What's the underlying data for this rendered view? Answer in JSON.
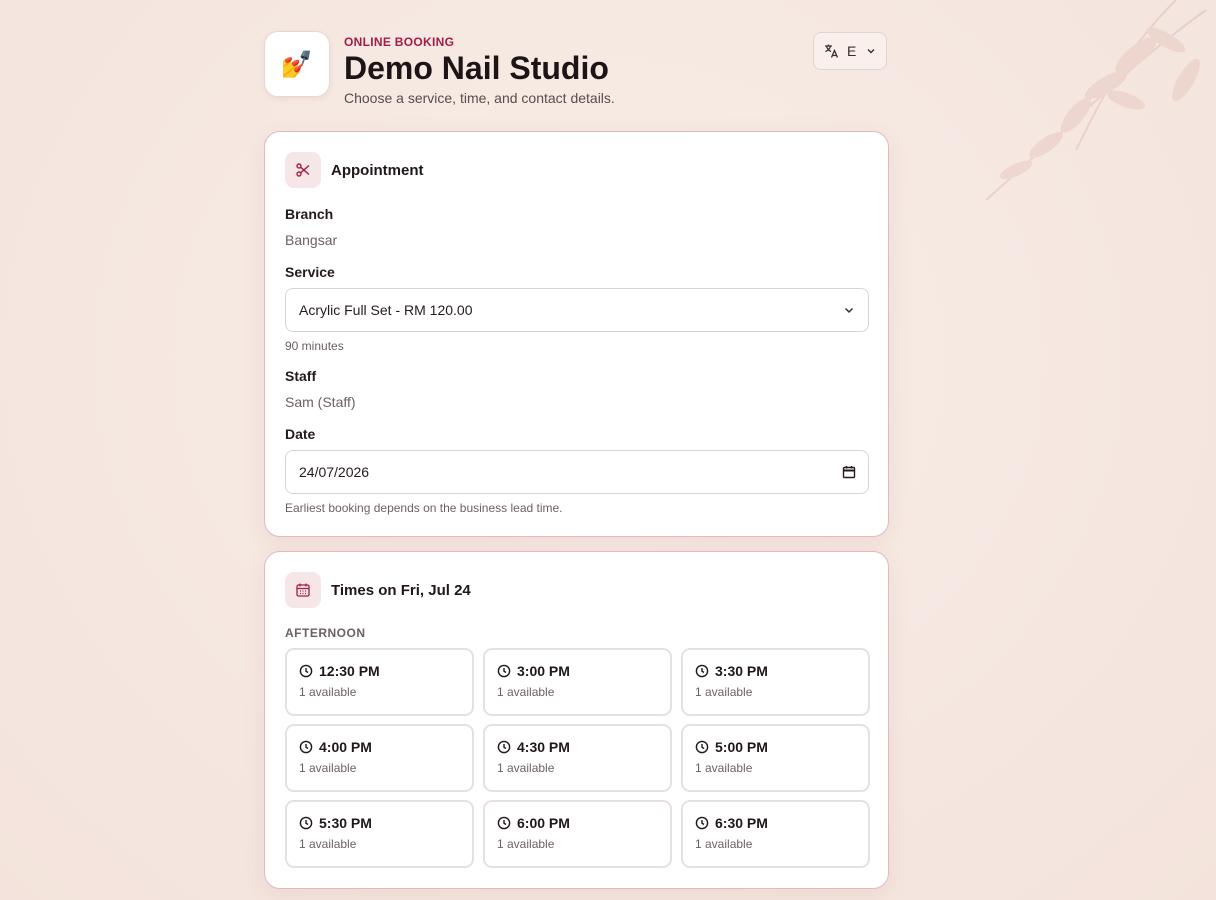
{
  "header": {
    "logo_emoji": "💅",
    "eyebrow": "ONLINE BOOKING",
    "title": "Demo Nail Studio",
    "subtitle": "Choose a service, time, and contact details.",
    "language_label": "E"
  },
  "appointment": {
    "title": "Appointment",
    "icon": "scissors-icon",
    "branch_label": "Branch",
    "branch_value": "Bangsar",
    "service_label": "Service",
    "service_value": "Acrylic Full Set - RM 120.00",
    "service_duration": "90 minutes",
    "staff_label": "Staff",
    "staff_value": "Sam (Staff)",
    "date_label": "Date",
    "date_value": "24/07/2026",
    "date_hint": "Earliest booking depends on the business lead time."
  },
  "times": {
    "title": "Times on Fri, Jul 24",
    "icon": "calendar-icon",
    "section_label": "AFTERNOON",
    "slots": [
      {
        "time": "12:30 PM",
        "availability": "1 available"
      },
      {
        "time": "3:00 PM",
        "availability": "1 available"
      },
      {
        "time": "3:30 PM",
        "availability": "1 available"
      },
      {
        "time": "4:00 PM",
        "availability": "1 available"
      },
      {
        "time": "4:30 PM",
        "availability": "1 available"
      },
      {
        "time": "5:00 PM",
        "availability": "1 available"
      },
      {
        "time": "5:30 PM",
        "availability": "1 available"
      },
      {
        "time": "6:00 PM",
        "availability": "1 available"
      },
      {
        "time": "6:30 PM",
        "availability": "1 available"
      }
    ]
  },
  "colors": {
    "accent": "#a11d48",
    "card_border": "#e2b9bf",
    "icon_bg": "#f7e6e8"
  }
}
